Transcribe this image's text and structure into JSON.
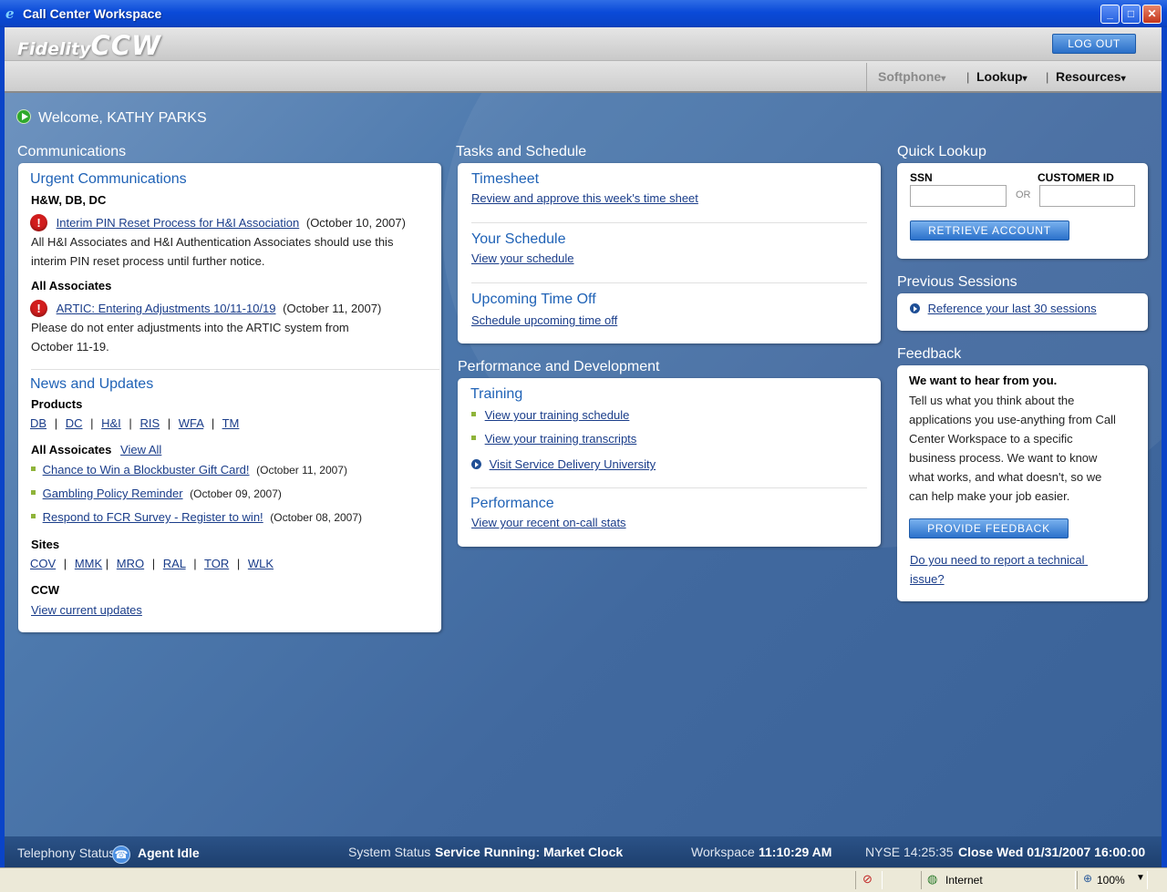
{
  "window": {
    "title": "Call Center Workspace",
    "buttons": {
      "minimize": "_",
      "maximize": "□",
      "close": "✕"
    }
  },
  "header": {
    "logo_prefix": "Fidelity",
    "logo_main": "CCW",
    "logout_label": "LOG OUT"
  },
  "nav": {
    "items": [
      {
        "label": "Softphone",
        "enabled": false
      },
      {
        "label": "Lookup",
        "enabled": true
      },
      {
        "label": "Resources",
        "enabled": true
      }
    ],
    "separator": "|",
    "arrow": "▾"
  },
  "welcome": "Welcome, KATHY PARKS",
  "communications": {
    "section_title": "Communications",
    "urgent": {
      "title": "Urgent Communications",
      "groups": [
        {
          "heading": "H&W, DB, DC",
          "link": "Interim PIN Reset Process for H&I Association",
          "date": "(October 10, 2007)",
          "body_lines": [
            "All H&I Associates and H&I Authentication Associates should use this",
            "interim PIN reset process until further notice."
          ]
        },
        {
          "heading": "All Associates",
          "link": "ARTIC: Entering Adjustments 10/11-10/19",
          "date": "(October 11, 2007)",
          "body_lines": [
            "Please do not enter adjustments into the ARTIC system from",
            "October 11-19."
          ]
        }
      ]
    },
    "news": {
      "title": "News and Updates",
      "products_heading": "Products",
      "products": [
        "DB",
        "DC",
        "H&I",
        "RIS",
        "WFA",
        "TM"
      ],
      "all_associates_heading": "All Assoicates",
      "view_all": "View All",
      "items": [
        {
          "link": "Chance to Win a Blockbuster Gift Card!",
          "date": "(October 11, 2007)"
        },
        {
          "link": "Gambling Policy Reminder",
          "date": "(October 09, 2007)"
        },
        {
          "link": "Respond to FCR Survey - Register to win!",
          "date": "(October 08, 2007)"
        }
      ],
      "sites_heading": "Sites",
      "sites": [
        "COV",
        "MMK",
        "MRO",
        "RAL",
        "TOR",
        "WLK"
      ],
      "ccw_heading": "CCW",
      "ccw_link": "View current updates"
    }
  },
  "tasks": {
    "section_title": "Tasks and Schedule",
    "items": [
      {
        "title": "Timesheet",
        "link": "Review and approve this week's time sheet"
      },
      {
        "title": "Your Schedule",
        "link": "View your schedule"
      },
      {
        "title": "Upcoming Time Off",
        "link": "Schedule upcoming time off"
      }
    ]
  },
  "performance": {
    "section_title": "Performance and Development",
    "training_title": "Training",
    "training_links": [
      "View your training schedule",
      "View your training transcripts",
      "Visit Service Delivery University"
    ],
    "performance_title": "Performance",
    "performance_link": "View your recent on-call stats"
  },
  "quick_lookup": {
    "section_title": "Quick Lookup",
    "ssn_label": "SSN",
    "or_label": "OR",
    "customer_id_label": "CUSTOMER ID",
    "ssn_value": "",
    "customer_id_value": "",
    "button": "RETRIEVE ACCOUNT"
  },
  "previous_sessions": {
    "section_title": "Previous Sessions",
    "link": "Reference your last 30 sessions"
  },
  "feedback": {
    "section_title": "Feedback",
    "heading": "We want to hear from you.",
    "body_lines": [
      "Tell us what you think about the",
      "applications you use-anything from Call",
      "Center Workspace to a specific",
      "business process.  We want to know",
      "what works, and what doesn't, so we",
      "can help make your job easier."
    ],
    "button": "PROVIDE FEEDBACK",
    "link_lines": [
      "Do you need to report a technical ",
      "issue?"
    ]
  },
  "statusbar": {
    "telephony_label": "Telephony Status",
    "telephony_value": "Agent Idle",
    "system_label": "System Status",
    "system_value": "Service Running: Market Clock",
    "workspace_label": "Workspace",
    "workspace_value": "11:10:29 AM",
    "nyse_label": "NYSE 14:25:35",
    "close_value": "Close Wed 01/31/2007 16:00:00"
  },
  "browser_status": {
    "zone": "Internet",
    "zoom": "100%"
  },
  "colors": {
    "accent_blue": "#1f62b6",
    "link_blue": "#1a3d8a",
    "alert_red": "#d21d1d",
    "bullet_green": "#8fb43a"
  }
}
